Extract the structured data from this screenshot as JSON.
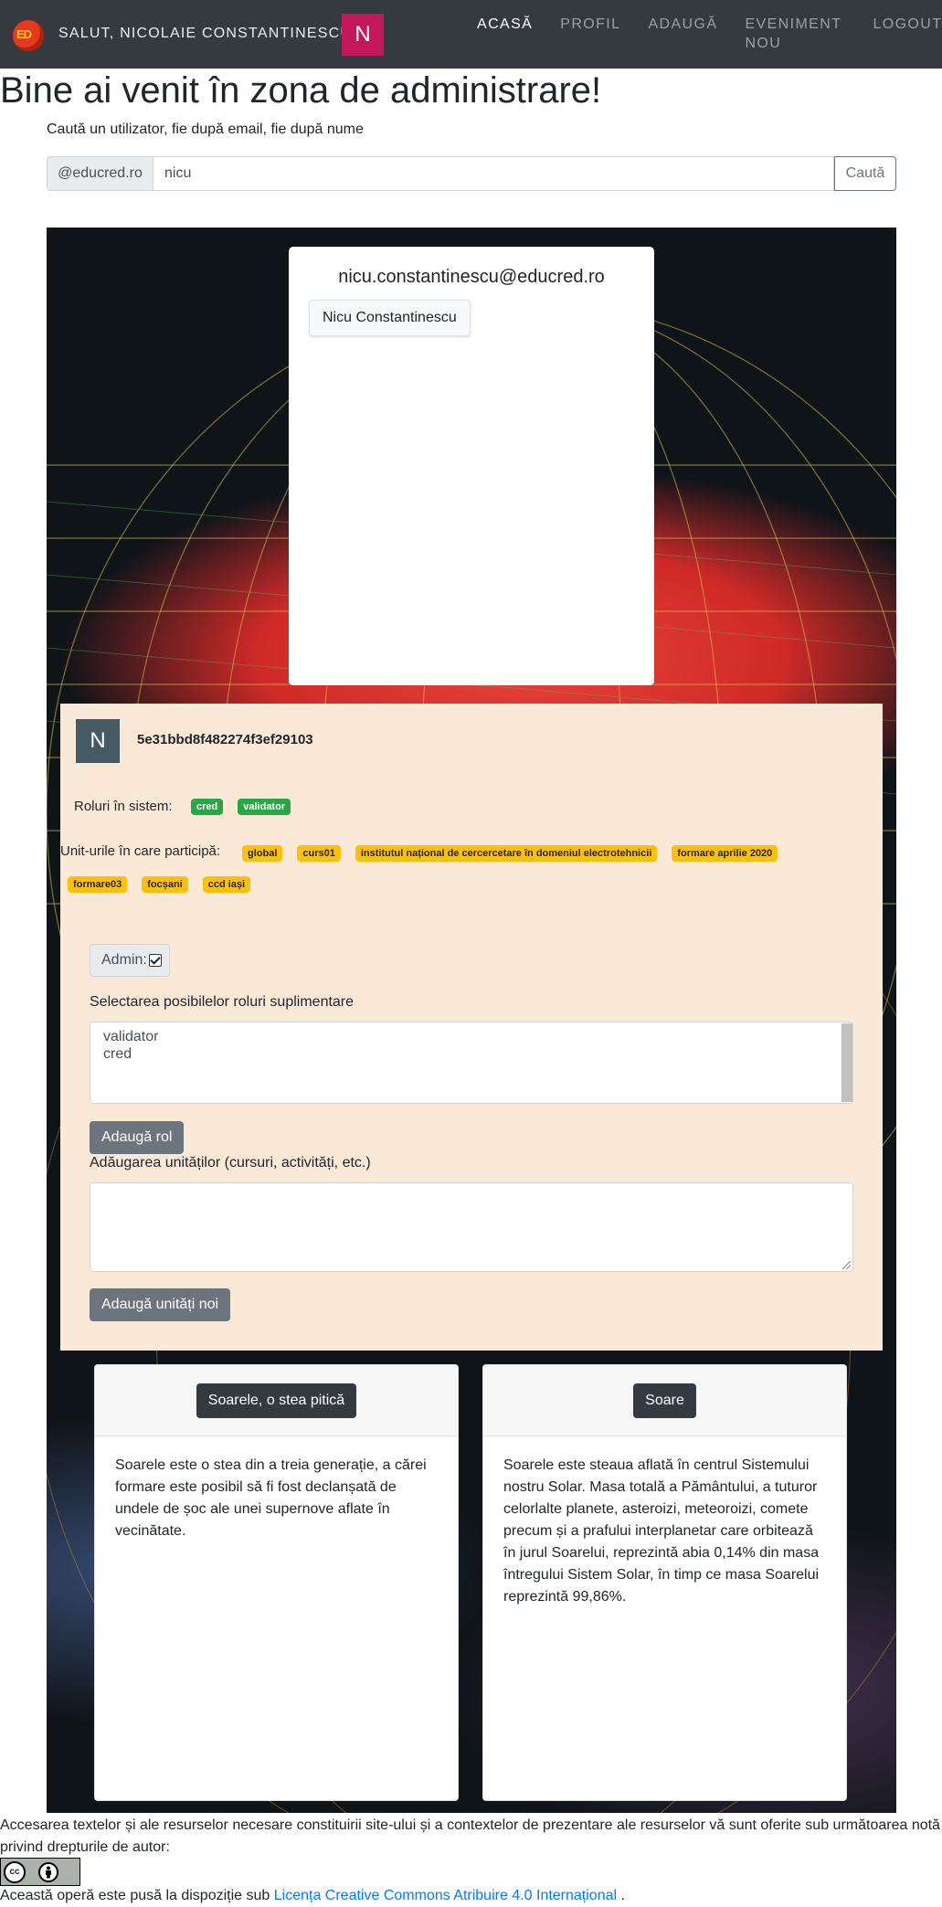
{
  "navbar": {
    "logo_text": "ED",
    "greeting": "SALUT, NICOLAIE CONSTANTINESCU",
    "avatar_letter": "N",
    "links": {
      "home": "ACASĂ",
      "profile": "PROFIL",
      "add": "ADAUGĂ",
      "new_event": "EVENIMENT NOU",
      "logout": "LOGOUT"
    }
  },
  "page_title": "Bine ai venit în zona de administrare!",
  "search": {
    "hint": "Caută un utilizator, fie după email, fie după nume",
    "domain_addon": "@educred.ro",
    "value": "nicu",
    "button_label": "Caută"
  },
  "user_card": {
    "email": "nicu.constantinescu@educred.ro",
    "name_button": "Nicu Constantinescu"
  },
  "details": {
    "avatar_letter": "N",
    "user_id": "5e31bbd8f482274f3ef29103",
    "roles_label": "Roluri în sistem:",
    "roles": [
      "cred",
      "validator"
    ],
    "units_label": "Unit-urile în care participă:",
    "units": [
      "global",
      "curs01",
      "institutul național de cercercetare în domeniul electrotehnicii",
      "formare aprilie 2020",
      "formare03",
      "focșani",
      "ccd iași"
    ],
    "admin_label": "Admin:",
    "admin_checked": true,
    "select_roles_label": "Selectarea posibilelor roluri suplimentare",
    "role_options": [
      "validator",
      "cred"
    ],
    "add_role_button": "Adaugă rol",
    "add_units_label": "Adăugarea unităților (cursuri, activități, etc.)",
    "add_units_button": "Adaugă unități noi"
  },
  "cards": [
    {
      "button": "Soarele, o stea pitică",
      "text": "Soarele este o stea din a treia generație, a cărei formare este posibil să fi fost declanșată de undele de șoc ale unei supernove aflate în vecinătate."
    },
    {
      "button": "Soare",
      "text": "Soarele este steaua aflată în centrul Sistemului nostru Solar. Masa totală a Pământului, a tuturor celorlalte planete, asteroizi, meteoroizi, comete precum și a prafului interplanetar care orbitează în jurul Soarelui, reprezintă abia 0,14% din masa întregului Sistem Solar, în timp ce masa Soarelui reprezintă 99,86%."
    }
  ],
  "footer": {
    "notice": "Accesarea textelor și ale resurselor necesare constituirii site-ului și a contextelor de prezentare ale resurselor vă sunt oferite sub următoarea notă privind drepturile de autor:",
    "cc_badge": {
      "cc": "cc",
      "by_icon": "person-icon",
      "by": "BY"
    },
    "license_prefix": "Această operă este pusă la dispoziție sub",
    "license_link": "Licența Creative Commons Atribuire 4.0 Internațional",
    "license_suffix": "."
  },
  "colors": {
    "navbar_bg": "#343a40",
    "nav_avatar": "#c2185b",
    "details_bg": "#fbe9d7",
    "details_avatar": "#455a64",
    "badge_green": "#28a745",
    "badge_yellow": "#ffc107",
    "button_gray": "#6c757d",
    "link_blue": "#007bff"
  }
}
